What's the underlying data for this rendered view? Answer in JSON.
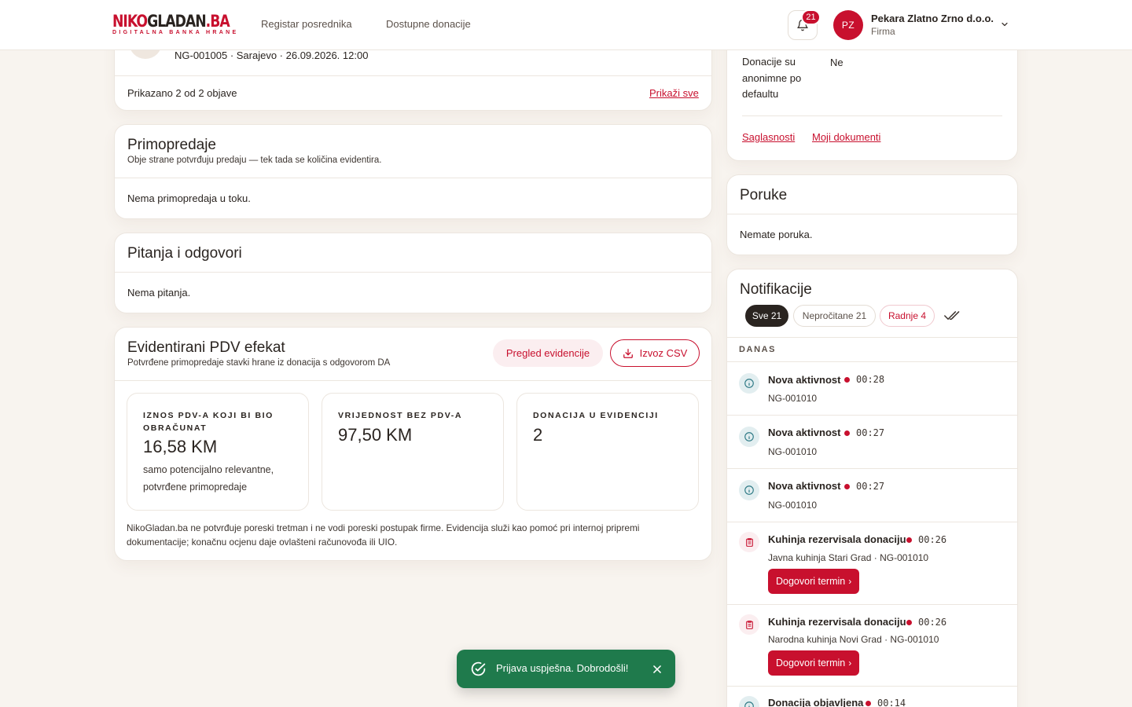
{
  "header": {
    "logo_part1": "NIKO",
    "logo_part2": "GLADAN",
    "logo_part3": ".BA",
    "logo_tagline": "DIGITALNA BANKA HRANE",
    "nav": [
      "Registar posrednika",
      "Dostupne donacije"
    ],
    "notification_count": "21",
    "user_initials": "PZ",
    "user_name": "Pekara Zlatno Zrno d.o.o.",
    "user_role": "Firma"
  },
  "listing": {
    "meta": "NG-001005 · Sarajevo · 26.09.2026. 12:00",
    "summary": "Prikazano 2 od 2 objave",
    "show_all": "Prikaži sve"
  },
  "handovers": {
    "title": "Primopredaje",
    "subtitle": "Obje strane potvrđuju predaju — tek tada se količina evidentira.",
    "empty": "Nema primopredaja u toku."
  },
  "qa": {
    "title": "Pitanja i odgovori",
    "empty": "Nema pitanja."
  },
  "vat": {
    "title": "Evidentirani PDV efekat",
    "subtitle": "Potvrđene primopredaje stavki hrane iz donacija s odgovorom DA",
    "review_button": "Pregled evidencije",
    "export_button": "Izvoz CSV",
    "stats": [
      {
        "label": "IZNOS PDV-A KOJI BI BIO OBRAČUNAT",
        "value": "16,58 KM",
        "note": "samo potencijalno relevantne, potvrđene primopredaje"
      },
      {
        "label": "VRIJEDNOST BEZ PDV-A",
        "value": "97,50 KM",
        "note": ""
      },
      {
        "label": "DONACIJA U EVIDENCIJI",
        "value": "2",
        "note": ""
      }
    ],
    "footnote": "NikoGladan.ba ne potvrđuje poreski tretman i ne vodi poreski postupak firme. Evidencija služi kao pomoć pri internoj pripremi dokumentacije; konačnu ocjenu daje ovlašteni računovođa ili UIO."
  },
  "settings": {
    "anon_label": "Donacije su anonimne po defaultu",
    "anon_value": "Ne",
    "consents_link": "Saglasnosti",
    "documents_link": "Moji dokumenti"
  },
  "messages": {
    "title": "Poruke",
    "empty": "Nemate poruka."
  },
  "notifications": {
    "title": "Notifikacije",
    "filters": [
      "Sve 21",
      "Nepročitane 21",
      "Radnje 4"
    ],
    "section": "DANAS",
    "items": [
      {
        "title": "Nova aktivnost",
        "time": "00:28",
        "sub": "NG-001010",
        "icon": "info-icon"
      },
      {
        "title": "Nova aktivnost",
        "time": "00:27",
        "sub": "NG-001010",
        "icon": "info-icon"
      },
      {
        "title": "Nova aktivnost",
        "time": "00:27",
        "sub": "NG-001010",
        "icon": "info-icon"
      },
      {
        "title": "Kuhinja rezervisala donaciju",
        "time": "00:26",
        "sub": "Javna kuhinja Stari Grad · NG-001010",
        "icon": "clipboard-icon",
        "action": "Dogovori termin"
      },
      {
        "title": "Kuhinja rezervisala donaciju",
        "time": "00:26",
        "sub": "Narodna kuhinja Novi Grad · NG-001010",
        "icon": "clipboard-icon",
        "action": "Dogovori termin"
      },
      {
        "title": "Donacija objavljena",
        "time": "00:14",
        "sub": "",
        "icon": "info-icon"
      }
    ]
  },
  "toast": {
    "message": "Prijava uspješna. Dobrodošli!"
  },
  "colors": {
    "brand_red": "#c8102e",
    "background": "#f8f4ef",
    "success_green": "#1f7a4c",
    "dark": "#2a2420"
  }
}
